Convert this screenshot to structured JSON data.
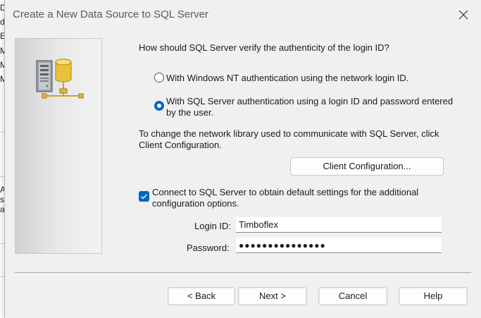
{
  "background": {
    "letters": [
      "D",
      "d",
      "E",
      "M",
      "M",
      "M",
      "A",
      "s",
      "a"
    ]
  },
  "dialog": {
    "title": "Create a New Data Source to SQL Server",
    "question": "How should SQL Server verify the authenticity of the login ID?",
    "auth_options": [
      {
        "label_line1": "With Windows NT authentication using the network login ID.",
        "label_line2": "",
        "selected": false
      },
      {
        "label_line1": "With SQL Server authentication using a login ID and password entered",
        "label_line2": "by the user.",
        "selected": true
      }
    ],
    "network_note_line1": "To change the network library used to communicate with SQL Server, click",
    "network_note_line2": "Client Configuration.",
    "client_config_button": "Client Configuration...",
    "connect_checkbox": {
      "checked": true,
      "label_line1": "Connect to SQL Server to obtain default settings for the additional",
      "label_line2": "configuration options."
    },
    "login": {
      "label": "Login ID:",
      "value": "Timboflex"
    },
    "password": {
      "label": "Password:",
      "masked_value": "●●●●●●●●●●●●●●●"
    },
    "buttons": {
      "back": "< Back",
      "next": "Next >",
      "cancel": "Cancel",
      "help": "Help"
    }
  },
  "colors": {
    "accent": "#0067c0",
    "dialog_bg": "#f0f0f0"
  },
  "icons": {
    "close": "close-icon",
    "server": "database-server-icon",
    "check": "checkmark-icon"
  }
}
